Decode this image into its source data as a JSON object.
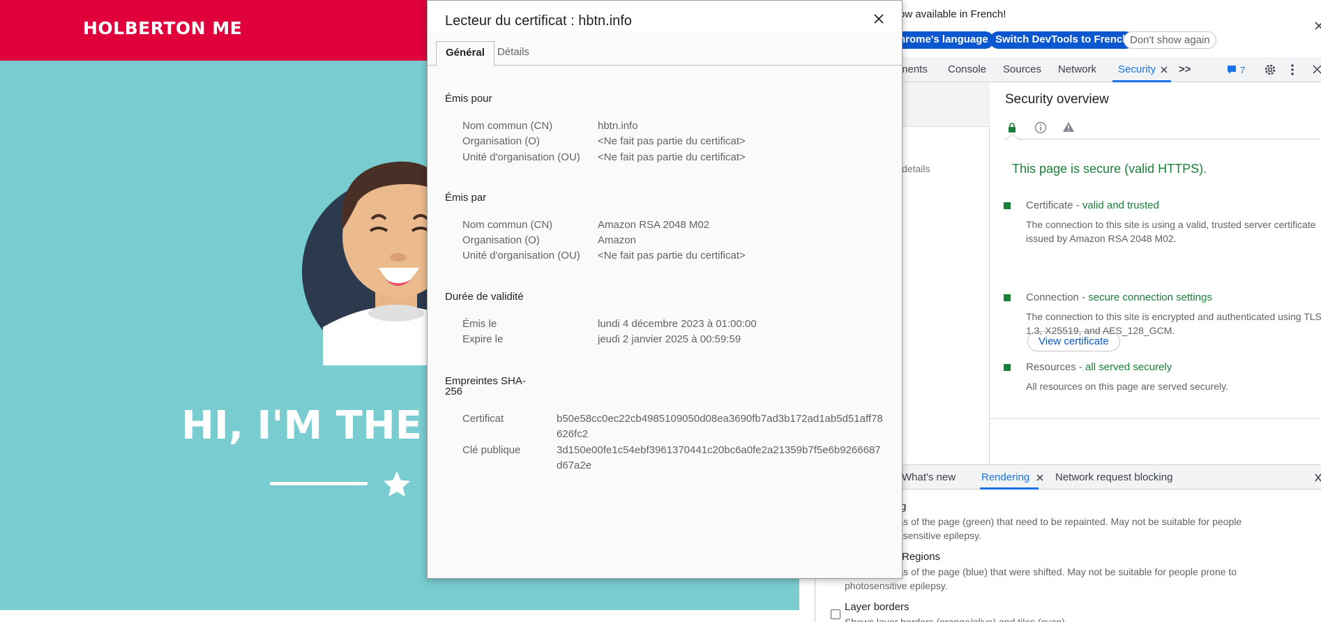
{
  "site": {
    "brand": "HOLBERTON ME",
    "hero_title": "HI, I'M THE C",
    "colors": {
      "header": "#e0003c",
      "hero": "#79cdd1"
    }
  },
  "devtools": {
    "infobar": {
      "message": "ow available in French!",
      "btn_language": "hrome's language",
      "btn_switch": "Switch DevTools to French",
      "btn_dont_show": "Don't show again"
    },
    "tabs": [
      "ments",
      "Console",
      "Sources",
      "Network",
      "Security"
    ],
    "more_icon": ">>",
    "issues_count": "7",
    "security": {
      "left_details": "details",
      "title": "Security overview",
      "summary": "This page is secure (valid HTTPS).",
      "items": [
        {
          "name": "Certificate",
          "status": "valid and trusted",
          "desc": "The connection to this site is using a valid, trusted server certificate issued by Amazon RSA 2048 M02."
        },
        {
          "name": "Connection",
          "status": "secure connection settings",
          "desc": "The connection to this site is encrypted and authenticated using TLS 1.3, X25519, and AES_128_GCM."
        },
        {
          "name": "Resources",
          "status": "all served securely",
          "desc": "All resources on this page are served securely."
        }
      ],
      "view_cert": "View certificate",
      "dash": " - "
    },
    "drawer": {
      "tabs": [
        "What's new",
        "Rendering",
        "Network request blocking"
      ],
      "items": [
        {
          "title": "g",
          "desc_line1": "reas of the page (green) that need to be repainted. May not be suitable for people",
          "desc_line2": "otosensitive epilepsy."
        },
        {
          "title": "Regions",
          "desc_line1": "reas of the page (blue) that were shifted. May not be suitable for people prone to",
          "desc_line2": "photosensitive epilepsy."
        },
        {
          "title": "Layer borders",
          "desc_line1": "Shows layer borders (orange/olive) and tiles (cyan)."
        }
      ]
    }
  },
  "cert": {
    "title": "Lecteur du certificat : hbtn.info",
    "tab_general": "Général",
    "tab_details": "Détails",
    "issued_to": {
      "heading": "Émis pour",
      "rows": [
        {
          "label": "Nom commun (CN)",
          "value": "hbtn.info"
        },
        {
          "label": "Organisation (O)",
          "value": "<Ne fait pas partie du certificat>"
        },
        {
          "label": "Unité d'organisation (OU)",
          "value": "<Ne fait pas partie du certificat>"
        }
      ]
    },
    "issued_by": {
      "heading": "Émis par",
      "rows": [
        {
          "label": "Nom commun (CN)",
          "value": "Amazon RSA 2048 M02"
        },
        {
          "label": "Organisation (O)",
          "value": "Amazon"
        },
        {
          "label": "Unité d'organisation (OU)",
          "value": "<Ne fait pas partie du certificat>"
        }
      ]
    },
    "validity": {
      "heading": "Durée de validité",
      "rows": [
        {
          "label": "Émis le",
          "value": "lundi 4 décembre 2023 à 01:00:00"
        },
        {
          "label": "Expire le",
          "value": "jeudi 2 janvier 2025 à 00:59:59"
        }
      ]
    },
    "fingerprints": {
      "heading_line1": "Empreintes SHA-",
      "heading_line2": "256",
      "certificate_label": "Certificat",
      "certificate_value": "b50e58cc0ec22cb4985109050d08ea3690fb7ad3b172ad1ab5d51aff78626fc2",
      "public_key_label": "Clé publique",
      "public_key_value": "3d150e00fe1c54ebf3961370441c20bc6a0fe2a21359b7f5e6b9266687d67a2e"
    }
  }
}
